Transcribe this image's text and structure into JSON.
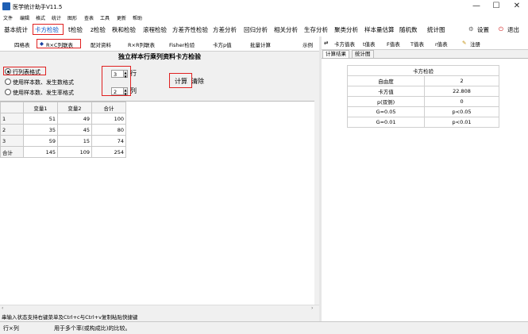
{
  "window": {
    "title": "医学统计助手V11.5",
    "minimize": "—",
    "maximize": "☐",
    "close": "✕"
  },
  "menu": [
    "文件",
    "编辑",
    "格式",
    "统计",
    "图形",
    "查表",
    "工具",
    "更新",
    "帮助"
  ],
  "toolbar": {
    "items": [
      "基本统计",
      "卡方检验",
      "t检验",
      "z检验",
      "秩和检验",
      "滚程检验",
      "方差齐性检验",
      "方差分析",
      "回归分析",
      "相关分析",
      "生存分析",
      "聚类分析",
      "样本量估算",
      "随机数",
      "统计图"
    ],
    "active": "卡方检验",
    "settings": "设置",
    "exit": "退出"
  },
  "left_tabs": {
    "items": [
      "四格表",
      "R×C列联表",
      "配对资料",
      "R×R列联表",
      "Fisher检验",
      "卡方p值",
      "批量计算"
    ],
    "active": "R×C列联表",
    "example": "示例"
  },
  "form": {
    "title": "独立样本行乘列资料卡方检验",
    "radio1": "行列表格式",
    "radio2": "使用样本数、发生数格式",
    "radio3": "使用样本数、发生率格式",
    "rows_value": "3",
    "rows_label": "行",
    "cols_value": "2",
    "cols_label": "列",
    "calc": "计算",
    "clear": "清除"
  },
  "grid": {
    "headers": [
      "",
      "变量1",
      "变量2",
      "合计"
    ],
    "rows": [
      [
        "1",
        "51",
        "49",
        "100"
      ],
      [
        "2",
        "35",
        "45",
        "80"
      ],
      [
        "3",
        "59",
        "15",
        "74"
      ],
      [
        "合计",
        "145",
        "109",
        "254"
      ]
    ]
  },
  "hint": "串输入状态支持右键菜单及Ctrl+c与Ctrl+v复制粘贴快捷键",
  "status": {
    "left": "行×列",
    "message": "用于多个率(或构成比)的比较。"
  },
  "right_toolbar": [
    "卡方值表",
    "t值表",
    "F值表",
    "T值表",
    "r值表",
    "注册"
  ],
  "right_tabs": [
    "计算结果",
    "统计图"
  ],
  "result": {
    "title": "卡方检验",
    "rows": [
      [
        "自由度",
        "2"
      ],
      [
        "卡方值",
        "22.808"
      ],
      [
        "p(双侧)",
        "0"
      ],
      [
        "G=0.05",
        "p<0.05"
      ],
      [
        "G=0.01",
        "p<0.01"
      ]
    ]
  }
}
